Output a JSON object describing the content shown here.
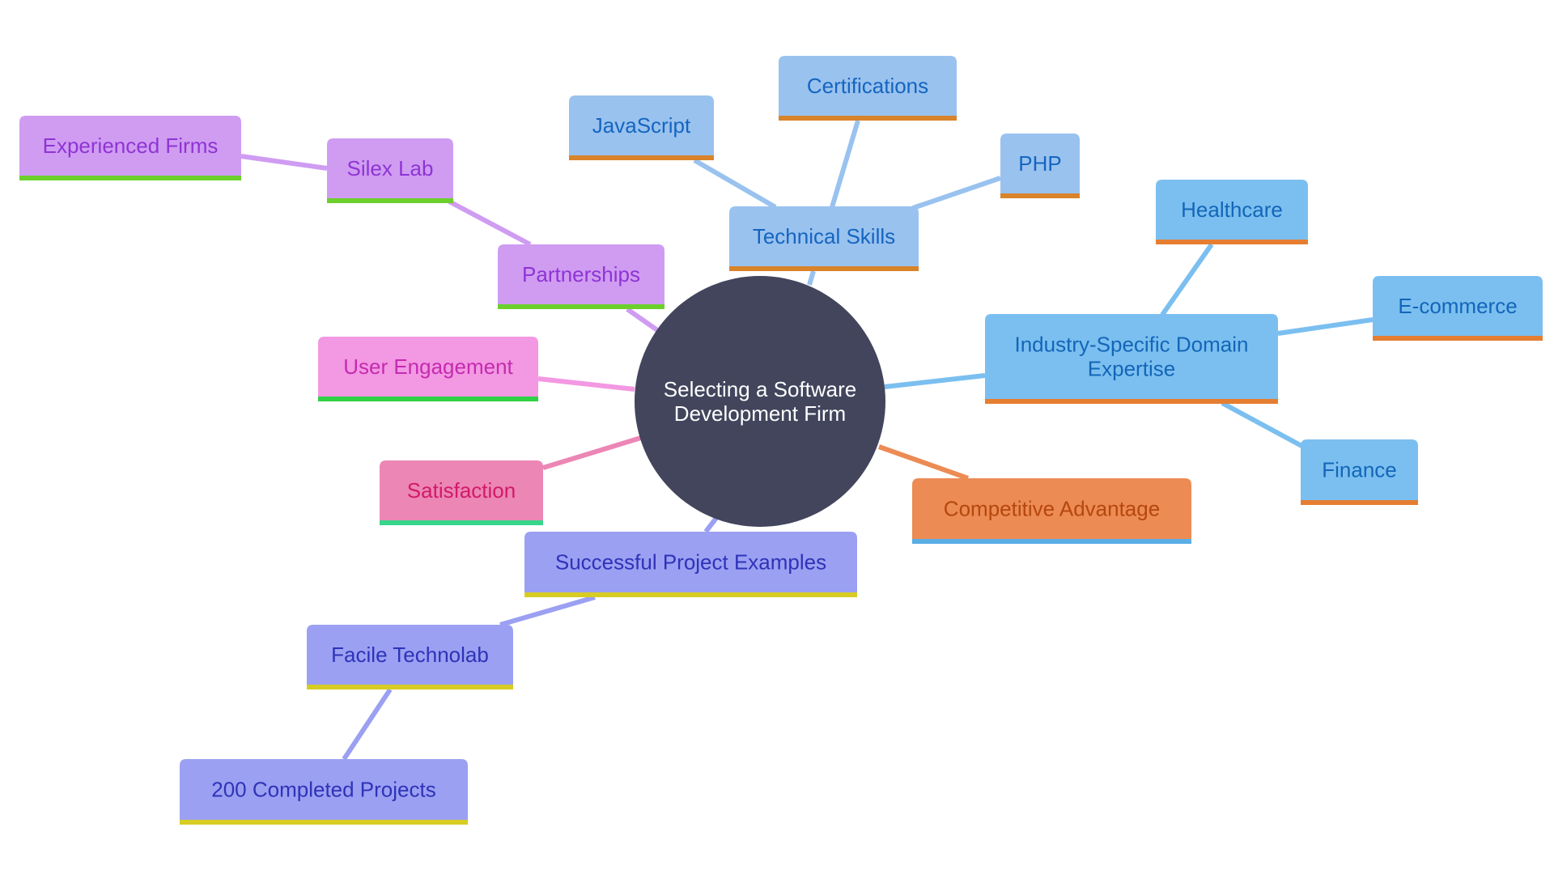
{
  "diagram": {
    "type": "mindmap",
    "root": {
      "id": "root",
      "lines": [
        "Selecting a Software",
        "Development Firm"
      ],
      "fill": "#42455c",
      "text_color": "#ffffff"
    },
    "branches": [
      {
        "id": "technical-skills",
        "label": "Technical Skills",
        "fill": "#99c2ef",
        "text": "#1565c0",
        "accent": "#d9832a",
        "line": "#99c2ef",
        "children": [
          {
            "id": "javascript",
            "label": "JavaScript"
          },
          {
            "id": "certifications",
            "label": "Certifications"
          },
          {
            "id": "php",
            "label": "PHP"
          }
        ]
      },
      {
        "id": "industry-domain",
        "label": "Industry-Specific Domain Expertise",
        "lines": [
          "Industry-Specific Domain",
          "Expertise"
        ],
        "fill": "#7bbff0",
        "text": "#1366b8",
        "accent": "#e67e32",
        "line": "#7bbff0",
        "children": [
          {
            "id": "healthcare",
            "label": "Healthcare"
          },
          {
            "id": "e-commerce",
            "label": "E-commerce"
          },
          {
            "id": "finance",
            "label": "Finance"
          }
        ]
      },
      {
        "id": "competitive-advantage",
        "label": "Competitive Advantage",
        "fill": "#ec8b54",
        "text": "#b5470f",
        "accent": "#5aaee6",
        "line": "#ec8b54",
        "children": []
      },
      {
        "id": "successful-projects",
        "label": "Successful Project Examples",
        "fill": "#9ba0f2",
        "text": "#2e33b8",
        "accent": "#d7cc24",
        "line": "#9ba0f2",
        "children": [
          {
            "id": "facile-technolab",
            "label": "Facile Technolab",
            "children": [
              {
                "id": "completed-projects",
                "label": "200 Completed Projects"
              }
            ]
          }
        ]
      },
      {
        "id": "satisfaction",
        "label": "Satisfaction",
        "fill": "#ec86b5",
        "text": "#d11a6a",
        "accent": "#36d68b",
        "line": "#ec86b5",
        "children": []
      },
      {
        "id": "user-engagement",
        "label": "User Engagement",
        "fill": "#f398e2",
        "text": "#c42bb0",
        "accent": "#2ed143",
        "line": "#f398e2",
        "children": []
      },
      {
        "id": "partnerships",
        "label": "Partnerships",
        "fill": "#cf9cf2",
        "text": "#8f34d4",
        "accent": "#6ccf2c",
        "line": "#cf9cf2",
        "children": [
          {
            "id": "silex-lab",
            "label": "Silex Lab",
            "children": [
              {
                "id": "experienced-firms",
                "label": "Experienced Firms"
              }
            ]
          }
        ]
      }
    ]
  }
}
